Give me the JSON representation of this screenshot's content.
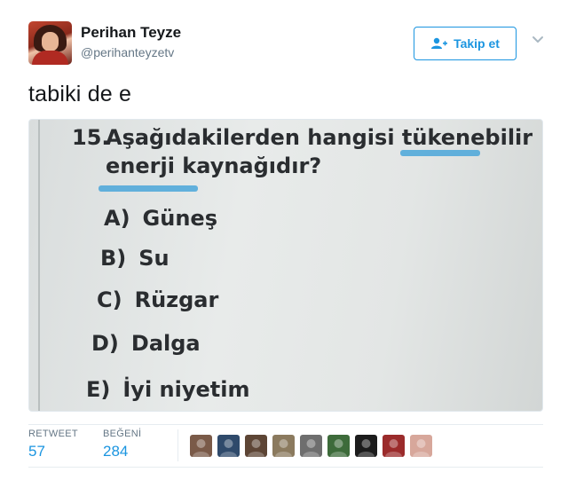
{
  "user": {
    "name": "Perihan Teyze",
    "handle": "@perihanteyzetv"
  },
  "follow_button": {
    "label": "Takip et"
  },
  "tweet": {
    "text": "tabiki de e"
  },
  "photo": {
    "question_number": "15.",
    "question_line1": "Aşağıdakilerden hangisi tükenebilir",
    "question_line2": "enerji kaynağıdır?",
    "options": [
      {
        "letter": "A)",
        "text": "Güneş"
      },
      {
        "letter": "B)",
        "text": "Su"
      },
      {
        "letter": "C)",
        "text": "Rüzgar"
      },
      {
        "letter": "D)",
        "text": "Dalga"
      },
      {
        "letter": "E)",
        "text": "İyi niyetim"
      }
    ]
  },
  "stats": {
    "retweets_label": "RETWEET",
    "retweets_value": "57",
    "likes_label": "BEĞENİ",
    "likes_value": "284"
  },
  "colors": {
    "accent": "#1b95e0",
    "muted": "#657786",
    "highlight": "#4aa6d9"
  },
  "likers": [
    {
      "icon": "user-avatar-icon",
      "color": "#7a5a48"
    },
    {
      "icon": "user-avatar-icon",
      "color": "#2f4a6b"
    },
    {
      "icon": "user-avatar-icon",
      "color": "#5d4535"
    },
    {
      "icon": "user-avatar-icon",
      "color": "#8b7a5e"
    },
    {
      "icon": "user-avatar-icon",
      "color": "#6e6e6e"
    },
    {
      "icon": "user-avatar-icon",
      "color": "#3d6b3a"
    },
    {
      "icon": "user-avatar-icon",
      "color": "#1c1c1c"
    },
    {
      "icon": "user-avatar-icon",
      "color": "#9b2b2b"
    },
    {
      "icon": "user-avatar-icon",
      "color": "#d7a79b"
    }
  ]
}
